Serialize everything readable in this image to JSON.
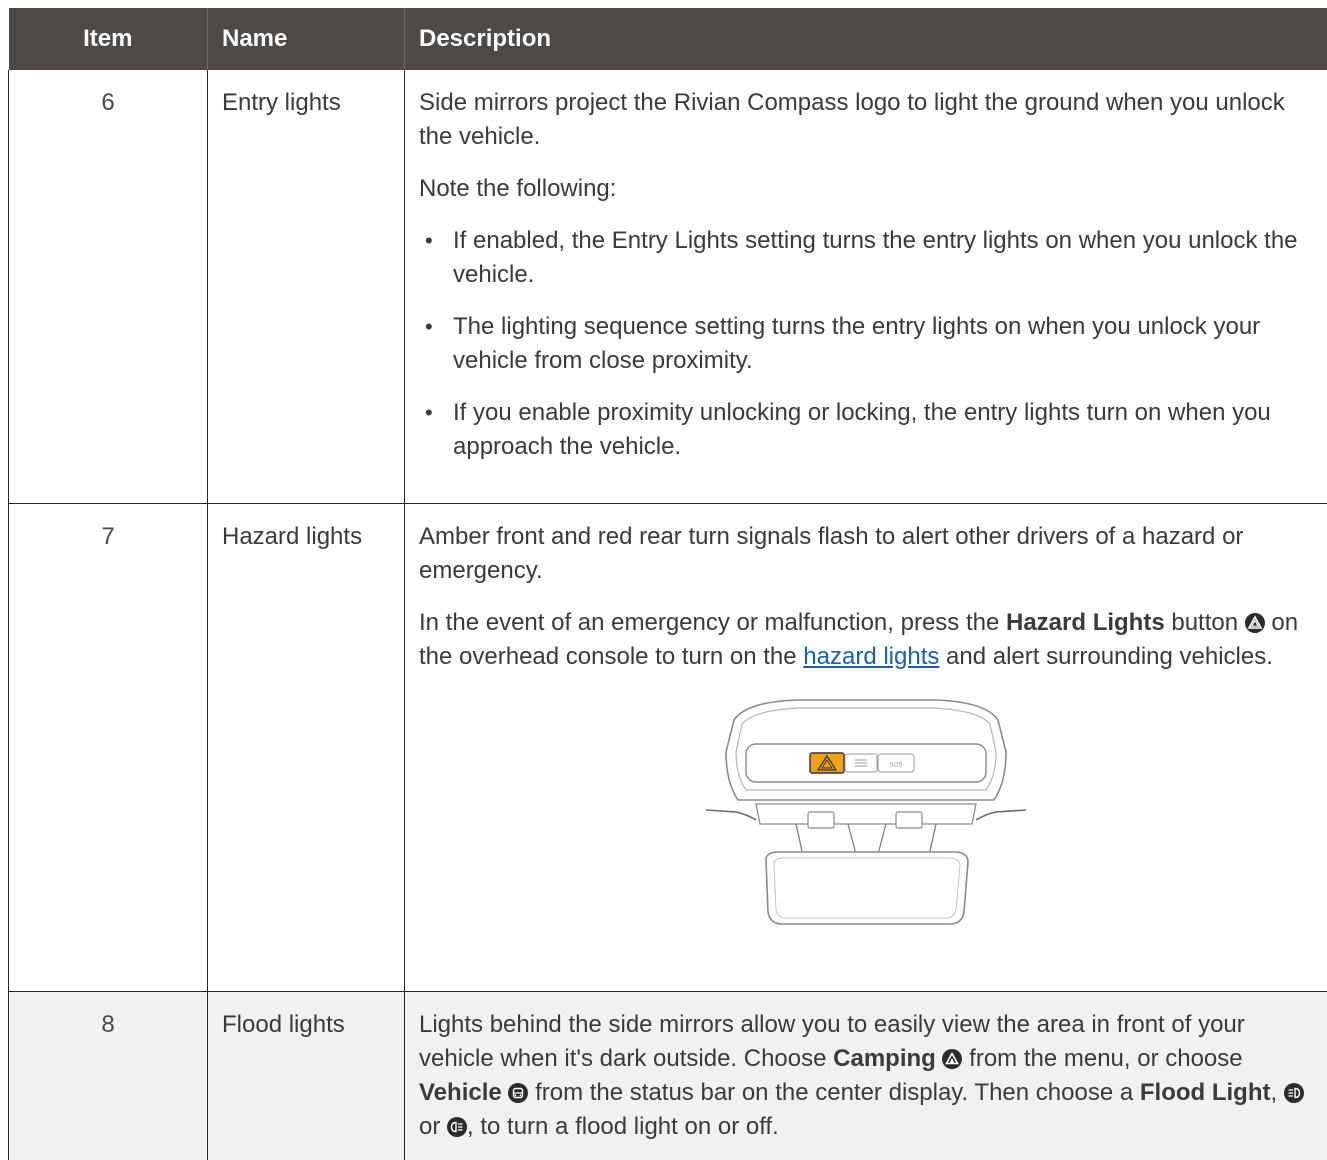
{
  "header": {
    "item": "Item",
    "name": "Name",
    "description": "Description"
  },
  "rows": [
    {
      "item": "6",
      "name": "Entry lights",
      "p1": "Side mirrors project the Rivian Compass logo to light the ground when you unlock the vehicle.",
      "p2": "Note the following:",
      "bullets": [
        "If enabled, the Entry Lights setting turns the entry lights on when you unlock the vehicle.",
        "The lighting sequence setting turns the entry lights on when you unlock your vehicle from close proximity.",
        "If you enable proximity unlocking or locking, the entry lights turn on when you approach the vehicle."
      ]
    },
    {
      "item": "7",
      "name": "Hazard lights",
      "p1": "Amber front and red rear turn signals flash to alert other drivers of a hazard or emergency.",
      "p2_a": "In the event of an emergency or malfunction, press the ",
      "p2_bold": "Hazard Lights",
      "p2_b": " button ",
      "p2_c": " on the overhead console to turn on the ",
      "p2_link": "hazard lights",
      "p2_d": " and alert surrounding vehicles.",
      "console_button_label": "SOS"
    },
    {
      "item": "8",
      "name": "Flood lights",
      "t1": "Lights behind the side mirrors allow you to easily view the area in front of your vehicle when it's dark outside. Choose ",
      "b1": "Camping",
      "t2": " from the menu, or choose ",
      "b2": "Vehicle",
      "t3": " from the status bar on the center display. Then choose a ",
      "b3": "Flood Light",
      "t4": ", ",
      "t5": " or ",
      "t6": ", to turn a flood light on or off."
    }
  ],
  "colors": {
    "header_bg": "#4d4947",
    "link": "#1a5fa8",
    "hazard_amber": "#f0a21c",
    "row_alt_bg": "#f1f1f1"
  },
  "icons": {
    "hazard": "hazard-triangle-icon",
    "camping": "camping-tent-icon",
    "vehicle": "vehicle-icon",
    "flood_left": "flood-light-left-icon",
    "flood_right": "flood-light-right-icon"
  }
}
